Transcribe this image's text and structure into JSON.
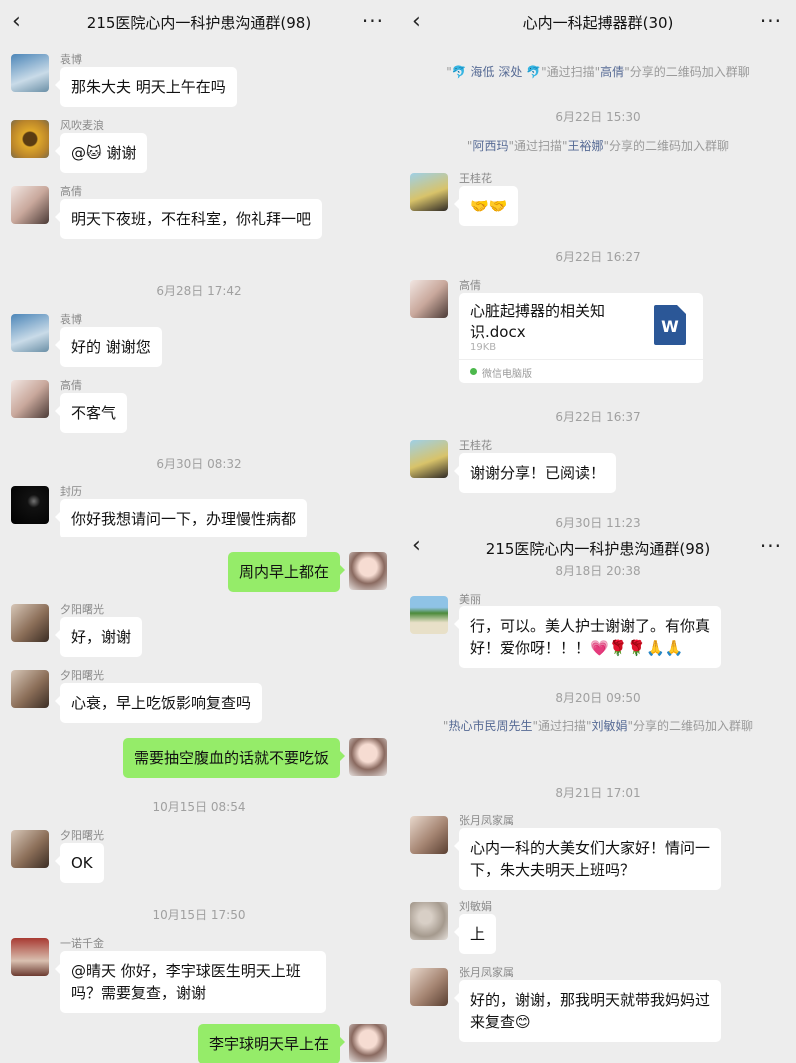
{
  "panel1": {
    "header": {
      "back": "‹",
      "title": "215医院心内一科护患沟通群(98)",
      "more": "···"
    },
    "messages": [
      {
        "sender": "袁博",
        "text": "那朱大夫 明天上午在吗"
      },
      {
        "sender": "风吹麦浪",
        "text": "@🐱 谢谢"
      },
      {
        "sender": "高倩",
        "text": "明天下夜班，不在科室，你礼拜一吧"
      },
      {
        "time": "6月28日 17:42"
      },
      {
        "sender": "袁博",
        "text": "好的 谢谢您"
      },
      {
        "sender": "高倩",
        "text": "不客气"
      },
      {
        "time": "6月30日 08:32"
      },
      {
        "sender": "封历",
        "text": "你好我想请问一下，办理慢性病都"
      },
      {
        "mine": true,
        "text": "周内早上都在"
      },
      {
        "sender": "夕阳曙光",
        "text": "好，谢谢"
      },
      {
        "sender": "夕阳曙光",
        "text": "心衰，早上吃饭影响复查吗"
      },
      {
        "mine": true,
        "text": "需要抽空腹血的话就不要吃饭"
      },
      {
        "time": "10月15日 08:54"
      },
      {
        "sender": "夕阳曙光",
        "text": "OK"
      },
      {
        "time": "10月15日 17:50"
      },
      {
        "sender": "一诺千金",
        "text": "@晴天 你好，李宇球医生明天上班吗？需要复查，谢谢"
      },
      {
        "mine": true,
        "text": "李宇球明天早上在"
      }
    ]
  },
  "panel2": {
    "header": {
      "back": "‹",
      "title": "心内一科起搏器群(30)",
      "more": "···"
    },
    "sys1": {
      "q1": "\"",
      "name1": "🐬 海低 深处 🐬",
      "mid": "\"通过扫描\"",
      "name2": "高倩",
      "end": "\"分享的二维码加入群聊"
    },
    "time1": "6月22日 15:30",
    "sys2": {
      "q1": "\"",
      "name1": "阿西玛",
      "mid": "\"通过扫描\"",
      "name2": "王裕娜",
      "end": "\"分享的二维码加入群聊"
    },
    "msg1": {
      "sender": "王桂花",
      "text": "🤝🤝"
    },
    "time2": "6月22日 16:27",
    "file": {
      "sender": "高倩",
      "name": "心脏起搏器的相关知识.docx",
      "size": "19KB",
      "source": "微信电脑版",
      "icon_letter": "W"
    },
    "time3": "6月22日 16:37",
    "msg2": {
      "sender": "王桂花",
      "text": "谢谢分享！已阅读！"
    },
    "time4": "6月30日 11:23"
  },
  "panel3": {
    "header": {
      "back": "‹",
      "title": "215医院心内一科护患沟通群(98)",
      "more": "···"
    },
    "time0": "8月18日 20:38",
    "msg1": {
      "sender": "美丽",
      "text": "行，可以。美人护士谢谢了。有你真好！爱你呀！！！💗🌹🌹🙏🙏"
    },
    "time1": "8月20日 09:50",
    "sys1": {
      "q1": "\"",
      "name1": "热心市民周先生",
      "mid": "\"通过扫描\"",
      "name2": "刘敏娟",
      "end": "\"分享的二维码加入群聊"
    },
    "time2": "8月21日 17:01",
    "msg2": {
      "sender": "张月凤家属",
      "text": "心内一科的大美女们大家好！情问一下，朱大夫明天上班吗？"
    },
    "msg3": {
      "sender": "刘敏娟",
      "text": "上"
    },
    "msg4": {
      "sender": "张月凤家属",
      "text": "好的，谢谢，那我明天就带我妈妈过来复查😊"
    }
  },
  "colors": {
    "bg": "#ededed",
    "bubble_mine": "#95ec69",
    "bubble_other": "#ffffff",
    "link": "#576b95",
    "doc_blue": "#2b5797"
  },
  "icons": {
    "back": "chevron-left-icon",
    "more": "more-icon",
    "doc": "word-doc-icon",
    "source": "wechat-icon"
  }
}
